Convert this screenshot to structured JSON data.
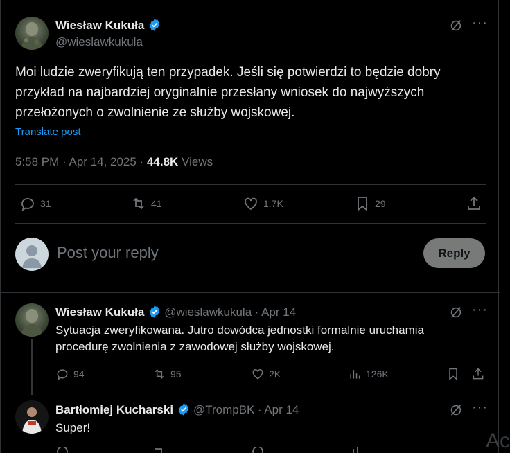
{
  "main_post": {
    "author_name": "Wiesław Kukuła",
    "author_handle": "@wieslawkukula",
    "text": "Moi ludzie zweryfikują ten przypadek. Jeśli się potwierdzi to będzie dobry przykład na najbardziej oryginalnie przesłany wniosek do najwyższych przełożonych o zwolnienie ze służby wojskowej.",
    "translate": "Translate post",
    "time": "5:58 PM · Apr 14, 2025 · ",
    "views_count": "44.8K",
    "views_label": " Views",
    "stats": {
      "replies": "31",
      "reposts": "41",
      "likes": "1.7K",
      "bookmarks": "29"
    }
  },
  "reply_box": {
    "placeholder": "Post your reply",
    "button": "Reply"
  },
  "replies": [
    {
      "author_name": "Wiesław Kukuła",
      "author_handle": "@wieslawkukula",
      "date": "· Apr 14",
      "text": "Sytuacja zweryfikowana. Jutro dowódca jednostki  formalnie uruchamia procedurę zwolnienia z zawodowej służby wojskowej.",
      "stats": {
        "replies": "94",
        "reposts": "95",
        "likes": "2K",
        "views": "126K"
      }
    },
    {
      "author_name": "Bartłomiej Kucharski",
      "author_handle": "@TrompBK",
      "date": "· Apr 14",
      "text": "Super!"
    }
  ],
  "side_text": "Ac",
  "colors": {
    "accent": "#1d9bf0",
    "muted": "#71767b",
    "text": "#e7e9ea",
    "bg": "#000000"
  }
}
